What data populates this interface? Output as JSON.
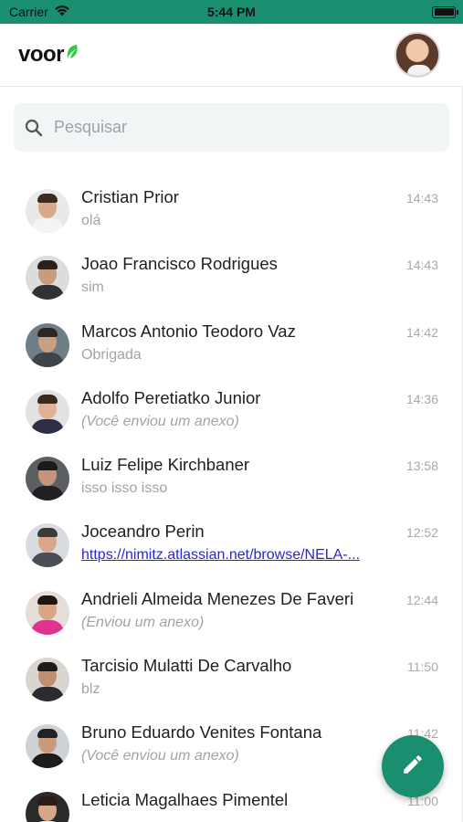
{
  "status_bar": {
    "carrier": "Carrier",
    "time": "5:44 PM",
    "battery_level": 1.0
  },
  "header": {
    "logo_text": "voor",
    "colors": {
      "brand": "#1a8f6f",
      "leaf": "#2ecc40"
    }
  },
  "search": {
    "placeholder": "Pesquisar",
    "value": ""
  },
  "conversations": [
    {
      "name": "Cristian Prior",
      "message": "olá",
      "time": "14:43",
      "style": "normal"
    },
    {
      "name": "Joao Francisco Rodrigues",
      "message": "sim",
      "time": "14:43",
      "style": "normal"
    },
    {
      "name": "Marcos Antonio Teodoro Vaz",
      "message": "Obrigada",
      "time": "14:42",
      "style": "normal"
    },
    {
      "name": "Adolfo Peretiatko Junior",
      "message": "(Você enviou um anexo)",
      "time": "14:36",
      "style": "italic"
    },
    {
      "name": "Luiz Felipe Kirchbaner",
      "message": "isso isso isso",
      "time": "13:58",
      "style": "normal"
    },
    {
      "name": "Joceandro Perin",
      "message": "https://nimitz.atlassian.net/browse/NELA-...",
      "time": "12:52",
      "style": "link"
    },
    {
      "name": "Andrieli Almeida Menezes De Faveri",
      "message": "(Enviou um anexo)",
      "time": "12:44",
      "style": "italic"
    },
    {
      "name": "Tarcisio Mulatti De Carvalho",
      "message": "blz",
      "time": "11:50",
      "style": "normal"
    },
    {
      "name": "Bruno Eduardo Venites Fontana",
      "message": "(Você enviou um anexo)",
      "time": "11:42",
      "style": "italic"
    },
    {
      "name": "Leticia Magalhaes Pimentel",
      "message": "",
      "time": "11:00",
      "style": "normal"
    }
  ],
  "fab": {
    "icon": "pencil-icon",
    "color": "#1a8f6f"
  }
}
